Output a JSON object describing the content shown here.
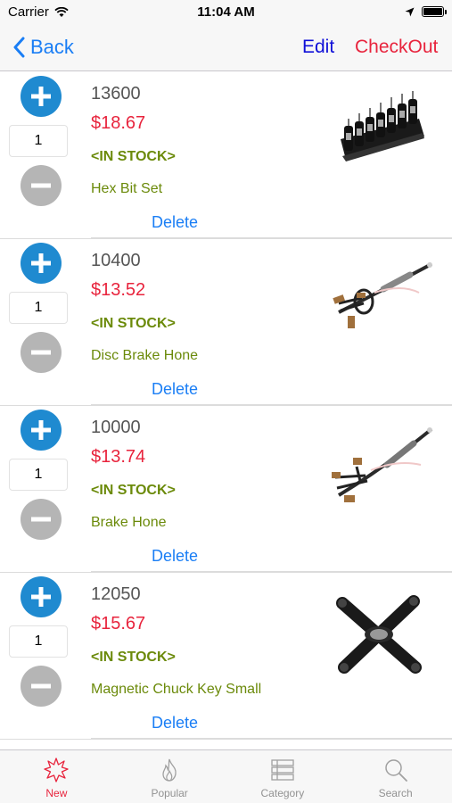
{
  "status_bar": {
    "carrier": "Carrier",
    "time": "11:04 AM"
  },
  "nav": {
    "back_label": "Back",
    "edit_label": "Edit",
    "checkout_label": "CheckOut"
  },
  "items": [
    {
      "sku": "13600",
      "price": "$18.67",
      "stock": "<IN STOCK>",
      "name": "Hex Bit Set",
      "qty": "1",
      "delete_label": "Delete",
      "image": "hex-bit-set"
    },
    {
      "sku": "10400",
      "price": "$13.52",
      "stock": "<IN STOCK>",
      "name": "Disc Brake Hone",
      "qty": "1",
      "delete_label": "Delete",
      "image": "disc-brake-hone"
    },
    {
      "sku": "10000",
      "price": "$13.74",
      "stock": "<IN STOCK>",
      "name": "Brake Hone",
      "qty": "1",
      "delete_label": "Delete",
      "image": "brake-hone"
    },
    {
      "sku": "12050",
      "price": "$15.67",
      "stock": "<IN STOCK>",
      "name": "Magnetic Chuck Key Small",
      "qty": "1",
      "delete_label": "Delete",
      "image": "chuck-key"
    }
  ],
  "tabs": [
    {
      "label": "New",
      "icon": "starburst-icon",
      "active": true
    },
    {
      "label": "Popular",
      "icon": "flame-icon",
      "active": false
    },
    {
      "label": "Category",
      "icon": "list-icon",
      "active": false
    },
    {
      "label": "Search",
      "icon": "search-icon",
      "active": false
    }
  ],
  "colors": {
    "accent_blue": "#1a7ef5",
    "edit_blue": "#1010d8",
    "red": "#e8243d",
    "stock_green": "#6b8a0a",
    "plus_blue": "#1f8ad0",
    "minus_gray": "#b5b5b5"
  }
}
